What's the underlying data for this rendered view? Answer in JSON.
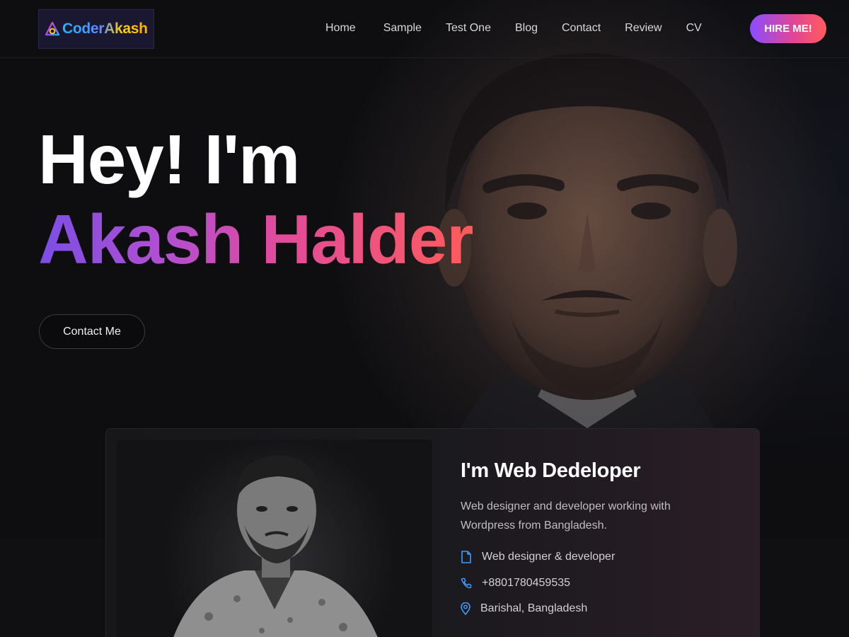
{
  "header": {
    "logo_text": "CoderAkash",
    "nav": [
      "Home",
      "Sample",
      "Test One",
      "Blog",
      "Contact",
      "Review",
      "CV"
    ],
    "hire_label": "HIRE ME!"
  },
  "hero": {
    "greeting": "Hey! I'm",
    "name": "Akash Halder",
    "contact_label": "Contact Me"
  },
  "card": {
    "title": "I'm Web Dedeloper",
    "description": "Web designer and developer working with Wordpress from Bangladesh.",
    "items": [
      {
        "icon": "document-icon",
        "text": "Web designer & developer"
      },
      {
        "icon": "phone-icon",
        "text": "+8801780459535"
      },
      {
        "icon": "location-pin-icon",
        "text": "Barishal, Bangladesh"
      }
    ]
  },
  "colors": {
    "accent_purple": "#8a4dff",
    "accent_pink": "#e5468f",
    "accent_red": "#ff5c5c",
    "icon_blue": "#3d9bff"
  }
}
